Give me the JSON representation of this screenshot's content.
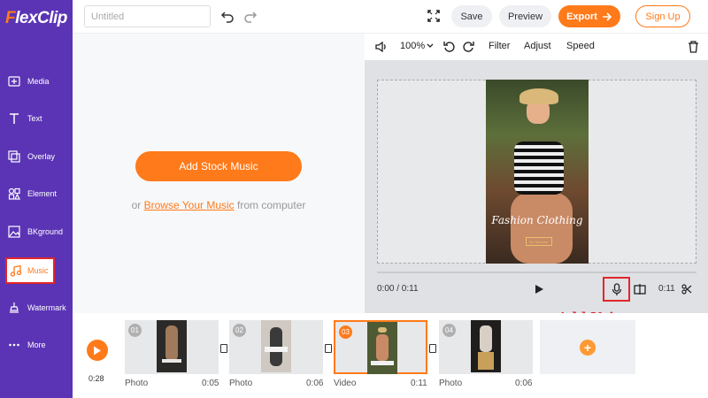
{
  "app": {
    "logo_f": "F",
    "logo_rest": "lexClip"
  },
  "sidebar": {
    "items": [
      {
        "label": "Media",
        "icon": "media-icon"
      },
      {
        "label": "Text",
        "icon": "text-icon"
      },
      {
        "label": "Overlay",
        "icon": "overlay-icon"
      },
      {
        "label": "Element",
        "icon": "element-icon"
      },
      {
        "label": "BKground",
        "icon": "background-icon"
      },
      {
        "label": "Music",
        "icon": "music-icon",
        "active": true
      },
      {
        "label": "Watermark",
        "icon": "watermark-icon"
      },
      {
        "label": "More",
        "icon": "more-icon"
      }
    ]
  },
  "topbar": {
    "title_placeholder": "Untitled",
    "save_label": "Save",
    "preview_label": "Preview",
    "export_label": "Export",
    "signup_label": "Sign Up"
  },
  "music_panel": {
    "add_stock_label": "Add Stock Music",
    "browse_prefix": "or ",
    "browse_link": "Browse Your Music",
    "browse_suffix": " from computer"
  },
  "preview_toolbar": {
    "zoom": "100%",
    "filter_label": "Filter",
    "adjust_label": "Adjust",
    "speed_label": "Speed"
  },
  "preview": {
    "caption": "Fashion Clothing",
    "subcaption": "for Summer",
    "current_time": "0:00 / 0:11",
    "clip_time": "0:11"
  },
  "annotation": "Add Voice-over",
  "timeline": {
    "total": "0:28",
    "clips": [
      {
        "num": "01",
        "type": "Photo",
        "duration": "0:05"
      },
      {
        "num": "02",
        "type": "Photo",
        "duration": "0:06"
      },
      {
        "num": "03",
        "type": "Video",
        "duration": "0:11",
        "selected": true
      },
      {
        "num": "04",
        "type": "Photo",
        "duration": "0:06"
      }
    ]
  },
  "colors": {
    "accent": "#ff7a1a",
    "sidebar": "#5b34b5",
    "highlight": "#e2262a"
  }
}
